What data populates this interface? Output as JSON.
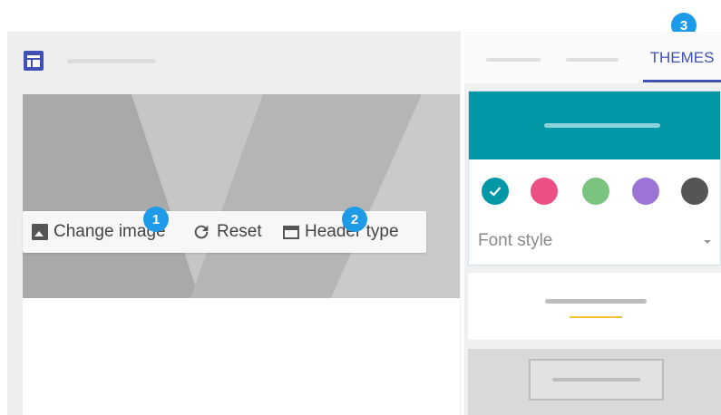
{
  "toolbar": {
    "change_image_label": "Change image",
    "reset_label": "Reset",
    "header_type_label": "Header type"
  },
  "badges": [
    "1",
    "2",
    "3"
  ],
  "themes_panel": {
    "active_tab_label": "THEMES",
    "color_swatches": [
      {
        "name": "teal",
        "color": "#0097a7",
        "selected": true
      },
      {
        "name": "pink",
        "color": "#ec4f86",
        "selected": false
      },
      {
        "name": "green",
        "color": "#7bc47f",
        "selected": false
      },
      {
        "name": "purple",
        "color": "#9c74d6",
        "selected": false
      },
      {
        "name": "gray",
        "color": "#555555",
        "selected": false
      }
    ],
    "font_style_label": "Font style"
  },
  "icons": {
    "app": "form-layout-icon",
    "change_image": "image-icon",
    "reset": "reset-icon",
    "header_type": "header-type-icon",
    "selected_swatch": "check-icon",
    "font_dropdown": "dropdown-arrow-icon"
  },
  "colors": {
    "accent": "#3f51b5",
    "theme_header": "#0097a7",
    "badge": "#1e9be8",
    "preview_accent": "#f0c23c"
  }
}
